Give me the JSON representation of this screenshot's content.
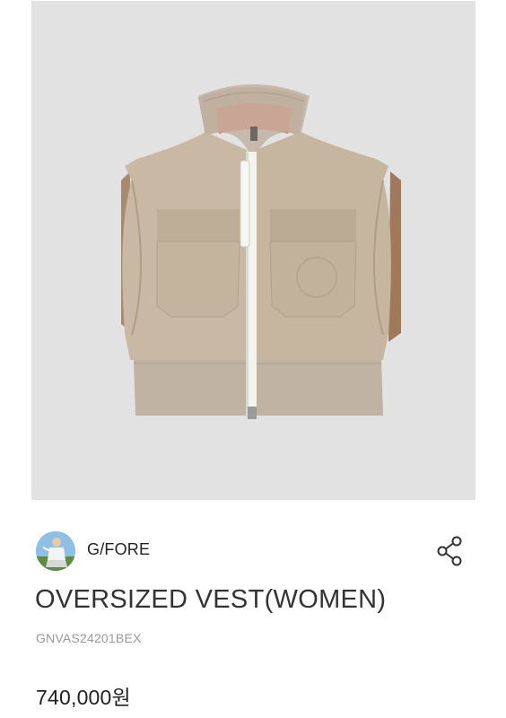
{
  "product": {
    "brand": "G/FORE",
    "name": "OVERSIZED VEST(WOMEN)",
    "code": "GNVAS24201BEX",
    "price": "740,000원"
  },
  "icons": {
    "share": "share-icon"
  },
  "colors": {
    "image_background": "#e2e2e3",
    "vest": "#c9b8a3",
    "accent_lining": "#f0614c"
  }
}
